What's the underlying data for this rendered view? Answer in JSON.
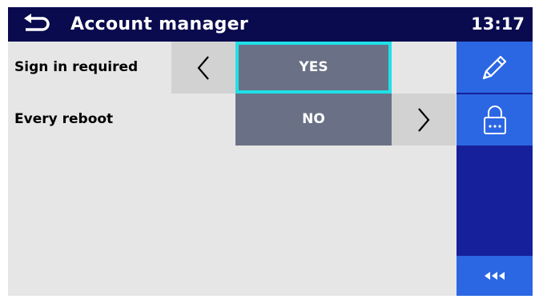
{
  "header": {
    "title": "Account manager",
    "time": "13:17",
    "icon": "back-arrow-icon"
  },
  "settings": [
    {
      "label": "Sign in required",
      "value": "YES",
      "selected": true,
      "arrows": [
        "left"
      ]
    },
    {
      "label": "Every reboot",
      "value": "NO",
      "selected": false,
      "arrows": [
        "right"
      ]
    }
  ],
  "side_panel": {
    "buttons": [
      {
        "name": "edit",
        "icon": "pencil-icon"
      },
      {
        "name": "lock",
        "icon": "padlock-icon"
      },
      {
        "name": "more",
        "icon": "triple-left-arrow-icon"
      }
    ]
  },
  "colors": {
    "header_bg": "#0a0a4e",
    "screen_bg": "#e6e6e6",
    "arrow_cell_bg": "#d2d2d2",
    "value_bg": "#6a7186",
    "selection_outline": "#1fe0e8",
    "side_panel_bg": "#16209a",
    "side_button_bg": "#2c67e3"
  }
}
